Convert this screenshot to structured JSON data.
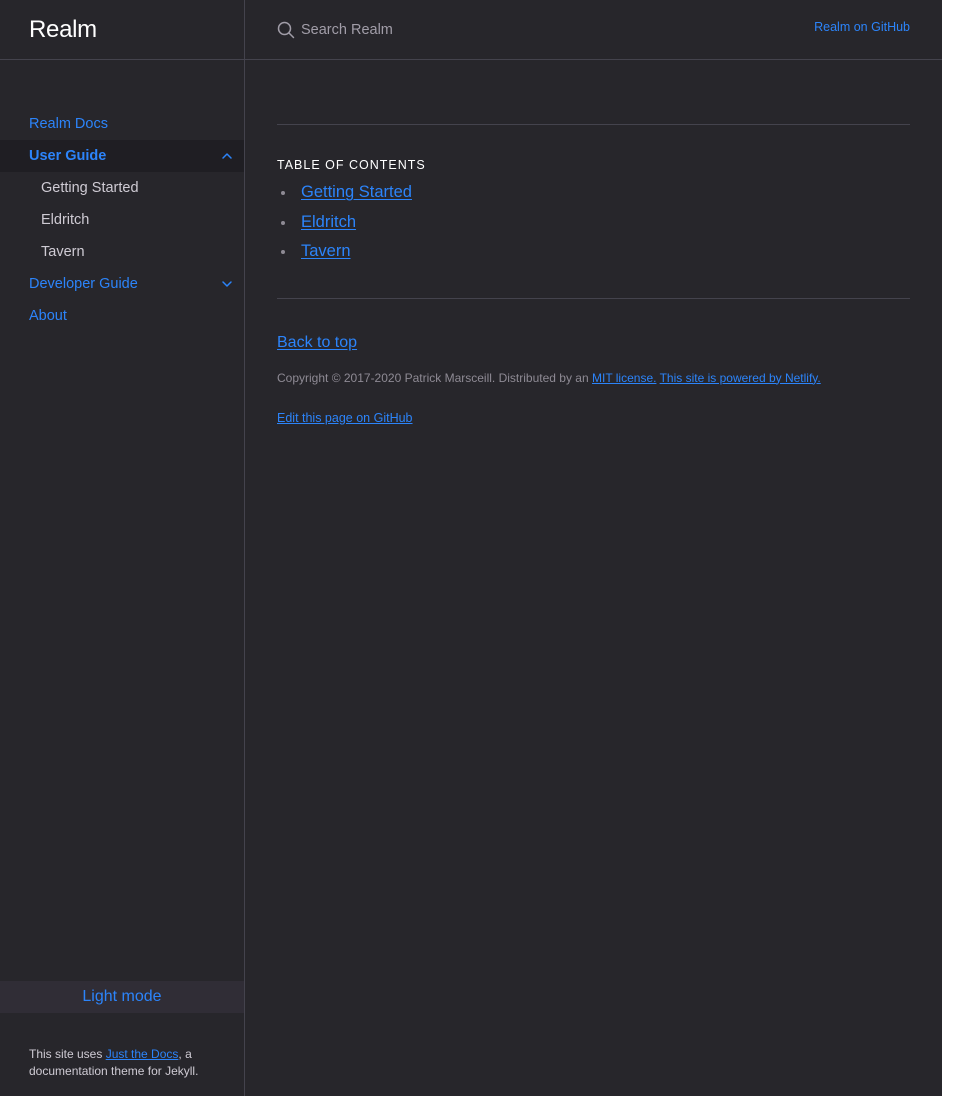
{
  "site": {
    "title": "Realm"
  },
  "search": {
    "placeholder": "Search Realm"
  },
  "header": {
    "aux_link": "Realm on GitHub"
  },
  "sidebar": {
    "items": [
      {
        "label": "Realm Docs"
      },
      {
        "label": "User Guide",
        "expanded": true
      },
      {
        "label": "Getting Started"
      },
      {
        "label": "Eldritch"
      },
      {
        "label": "Tavern"
      },
      {
        "label": "Developer Guide",
        "expanded": false
      },
      {
        "label": "About"
      }
    ],
    "theme_toggle": "Light mode",
    "footer": {
      "prefix": "This site uses ",
      "link": "Just the Docs",
      "suffix": ", a documentation theme for Jekyll."
    }
  },
  "main": {
    "toc_heading": "TABLE OF CONTENTS",
    "toc": [
      {
        "label": "Getting Started"
      },
      {
        "label": "Eldritch"
      },
      {
        "label": "Tavern"
      }
    ],
    "back_to_top": "Back to top",
    "copyright": {
      "text": "Copyright © 2017-2020 Patrick Marsceill. Distributed by an ",
      "license_link": "MIT license.",
      "netlify_link": "This site is powered by Netlify."
    },
    "edit_link": "Edit this page on GitHub"
  },
  "colors": {
    "background": "#27262b",
    "link": "#2c84fa",
    "border": "#44434d"
  }
}
